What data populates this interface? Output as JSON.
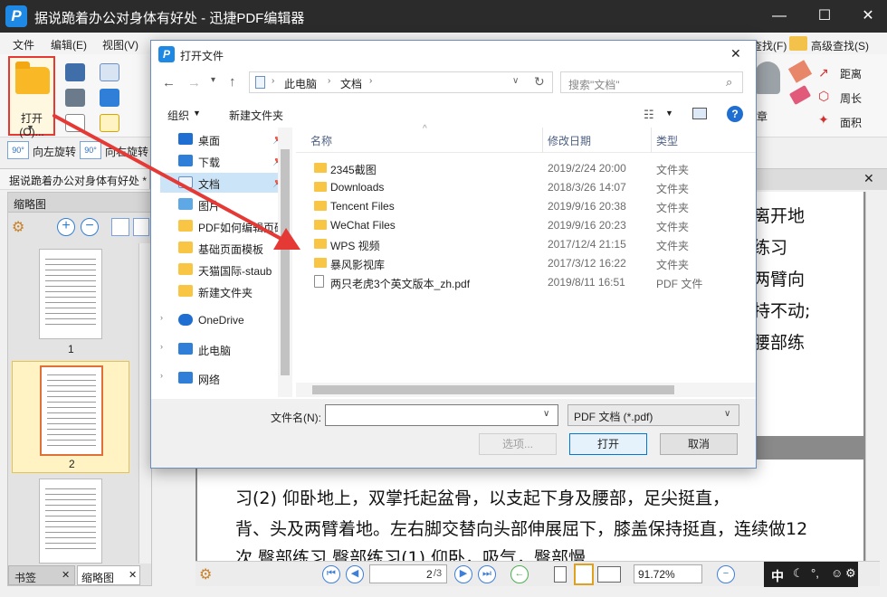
{
  "app": {
    "title": "据说跪着办公对身体有好处 - 迅捷PDF编辑器",
    "logo_letter": "P",
    "minimize": "—",
    "maximize": "☐",
    "close": "✕"
  },
  "menu": [
    "文件",
    "编辑(E)",
    "视图(V)"
  ],
  "ribbon": {
    "open_label": "打开(O)...",
    "rotate_left": "向左旋转",
    "rotate_right": "向右旋转",
    "rotate_badge": "90°",
    "find_partial": "查找(F)",
    "advanced_find": "高级查找(S)",
    "stamp_partial": "章",
    "distance": "距离",
    "perimeter": "周长",
    "area": "面积"
  },
  "doc_tab": {
    "label": "据说跪着办公对身体有好处 *",
    "close": "✕"
  },
  "left_panel": {
    "title": "缩略图",
    "pages": [
      "1",
      "2"
    ],
    "tabs": [
      {
        "label": "书签"
      },
      {
        "label": "缩略图"
      }
    ]
  },
  "document": {
    "right_text": [
      "离开地",
      "练习",
      "两臂向",
      "持不动;",
      "腰部练"
    ],
    "body_line1": "习(2)          仰卧地上，双掌托起盆骨，以支起下身及腰部，足尖挺直，",
    "body_line2": "背、头及两臂着地。左右脚交替向头部伸展屈下，膝盖保持挺直，连续做12",
    "body_line3": "次          臀部练习          臀部练习(1)          仰卧，吸气，臀部慢"
  },
  "bottom_bar": {
    "page_value": "2",
    "page_total": "/3",
    "zoom": "91.72%"
  },
  "ime": {
    "label": "中"
  },
  "dialog": {
    "title": "打开文件",
    "close": "✕",
    "breadcrumb": [
      "此电脑",
      "文档"
    ],
    "search_placeholder": "搜索\"文档\"",
    "organize": "组织",
    "new_folder": "新建文件夹",
    "help": "?",
    "nav_items": [
      {
        "label": "桌面",
        "color": "#1e6fd1"
      },
      {
        "label": "下载",
        "color": "#2f7fd8"
      },
      {
        "label": "文档",
        "color": "#d9e4f0"
      },
      {
        "label": "图片",
        "color": "#5fa8e6"
      },
      {
        "label": "PDF如何编辑页码",
        "color": "#f9c545"
      },
      {
        "label": "基础页面模板",
        "color": "#f9c545"
      },
      {
        "label": "天猫国际-staub",
        "color": "#f9c545"
      },
      {
        "label": "新建文件夹",
        "color": "#f9c545"
      },
      {
        "label": "OneDrive",
        "color": "#1e6fd1"
      },
      {
        "label": "此电脑",
        "color": "#2f7fd8"
      },
      {
        "label": "网络",
        "color": "#2f7fd8"
      }
    ],
    "columns": {
      "name": "名称",
      "date": "修改日期",
      "type": "类型"
    },
    "files": [
      {
        "name": "2345截图",
        "date": "2019/2/24 20:00",
        "type": "文件夹",
        "kind": "folder"
      },
      {
        "name": "Downloads",
        "date": "2018/3/26 14:07",
        "type": "文件夹",
        "kind": "folder"
      },
      {
        "name": "Tencent Files",
        "date": "2019/9/16 20:38",
        "type": "文件夹",
        "kind": "folder"
      },
      {
        "name": "WeChat Files",
        "date": "2019/9/16 20:23",
        "type": "文件夹",
        "kind": "folder"
      },
      {
        "name": "WPS 视频",
        "date": "2017/12/4 21:15",
        "type": "文件夹",
        "kind": "folder"
      },
      {
        "name": "暴风影视库",
        "date": "2017/3/12 16:22",
        "type": "文件夹",
        "kind": "folder"
      },
      {
        "name": "两只老虎3个英文版本_zh.pdf",
        "date": "2019/8/11 16:51",
        "type": "PDF 文件",
        "kind": "pdf"
      }
    ],
    "filename_label": "文件名(N):",
    "filename_value": "",
    "filetype": "PDF 文档 (*.pdf)",
    "options": "选项...",
    "open": "打开",
    "cancel": "取消"
  },
  "colors": {
    "accent": "#0078d7",
    "highlight_border": "#e53935",
    "folder": "#f9c545"
  }
}
